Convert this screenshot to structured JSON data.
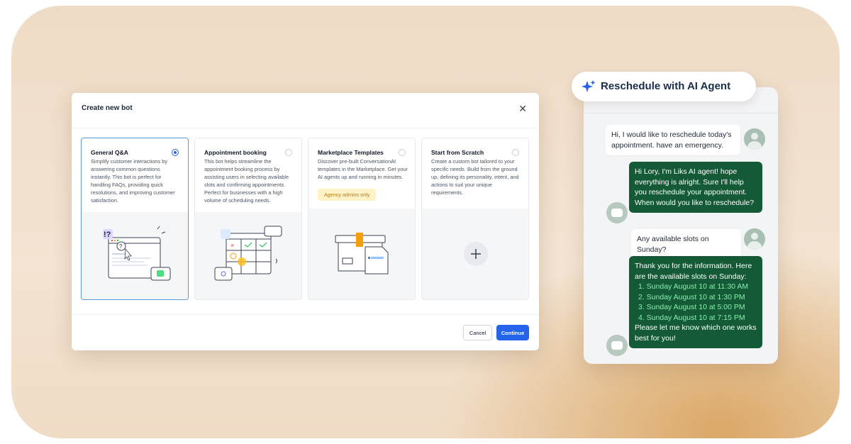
{
  "modal": {
    "title": "Create new bot",
    "close_icon": "close-icon",
    "cards": [
      {
        "title": "General Q&A",
        "selected": true,
        "description": "Simplify customer interactions by answering common questions instantly. This bot is perfect for handling FAQs, providing quick resolutions, and improving customer satisfaction."
      },
      {
        "title": "Appointment booking",
        "selected": false,
        "description": "This bot helps streamline the appointment booking process by assisting users in selecting available slots and confirming appointments. Perfect for businesses with a high volume of scheduling needs."
      },
      {
        "title": "Marketplace Templates",
        "selected": false,
        "description": "Discover pre-built ConversationAI templates in the Marketplace. Get your AI agents up and running in minutes.",
        "badge": "Agency admins only"
      },
      {
        "title": "Start from Scratch",
        "selected": false,
        "description": "Create a custom bot tailored to your specific needs. Build from the ground up, defining its personality, intent, and actions to suit your unique requirements."
      }
    ],
    "cancel_label": "Cancel",
    "continue_label": "Continue"
  },
  "agent_pill": {
    "label": "Reschedule with AI Agent",
    "icon": "sparkle-icon"
  },
  "chat": {
    "messages": [
      {
        "role": "user",
        "text": "Hi, I would like to reschedule today's appointment. have an emergency."
      },
      {
        "role": "bot",
        "text": "Hi Lory, I'm Liks AI agent! hope everything is alright. Sure I'll help you reschedule your appointment. When would you like to reschedule?"
      },
      {
        "role": "user",
        "text": "Any available slots on Sunday?"
      },
      {
        "role": "bot",
        "intro": "Thank you for the information. Here are the available slots on Sunday:",
        "slots": [
          "1. Sunday August 10 at 11:30 AM",
          "2. Sunday August 10 at 1:30 PM",
          "3. Sunday August 10 at 5:00 PM",
          "4. Sunday August 10 at 7:15 PM"
        ],
        "outro": "Please let me know which one works best for you!"
      }
    ]
  },
  "colors": {
    "accent": "#2563eb",
    "bot_bubble": "#145a36",
    "slot_text": "#86efac",
    "badge_bg": "#fdf3c6"
  }
}
